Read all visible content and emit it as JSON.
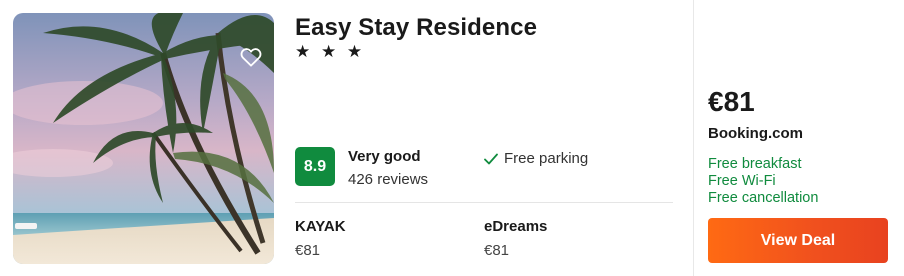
{
  "hotel": {
    "name": "Easy Stay Residence",
    "stars": "★ ★ ★",
    "star_count": 3
  },
  "rating": {
    "score": "8.9",
    "label": "Very good",
    "reviews": "426 reviews",
    "badge_color": "#108b3e"
  },
  "amenities": [
    {
      "label": "Free parking",
      "icon": "check-icon"
    }
  ],
  "providers": [
    {
      "name": "KAYAK",
      "price": "€81"
    },
    {
      "name": "eDreams",
      "price": "€81"
    }
  ],
  "deal": {
    "price": "€81",
    "site": "Booking.com",
    "perks": [
      "Free breakfast",
      "Free Wi-Fi",
      "Free cancellation"
    ],
    "perk_color": "#108b3e",
    "button_label": "View Deal",
    "button_color": "#f0501e"
  },
  "icons": {
    "favorite": "heart-outline-icon"
  }
}
